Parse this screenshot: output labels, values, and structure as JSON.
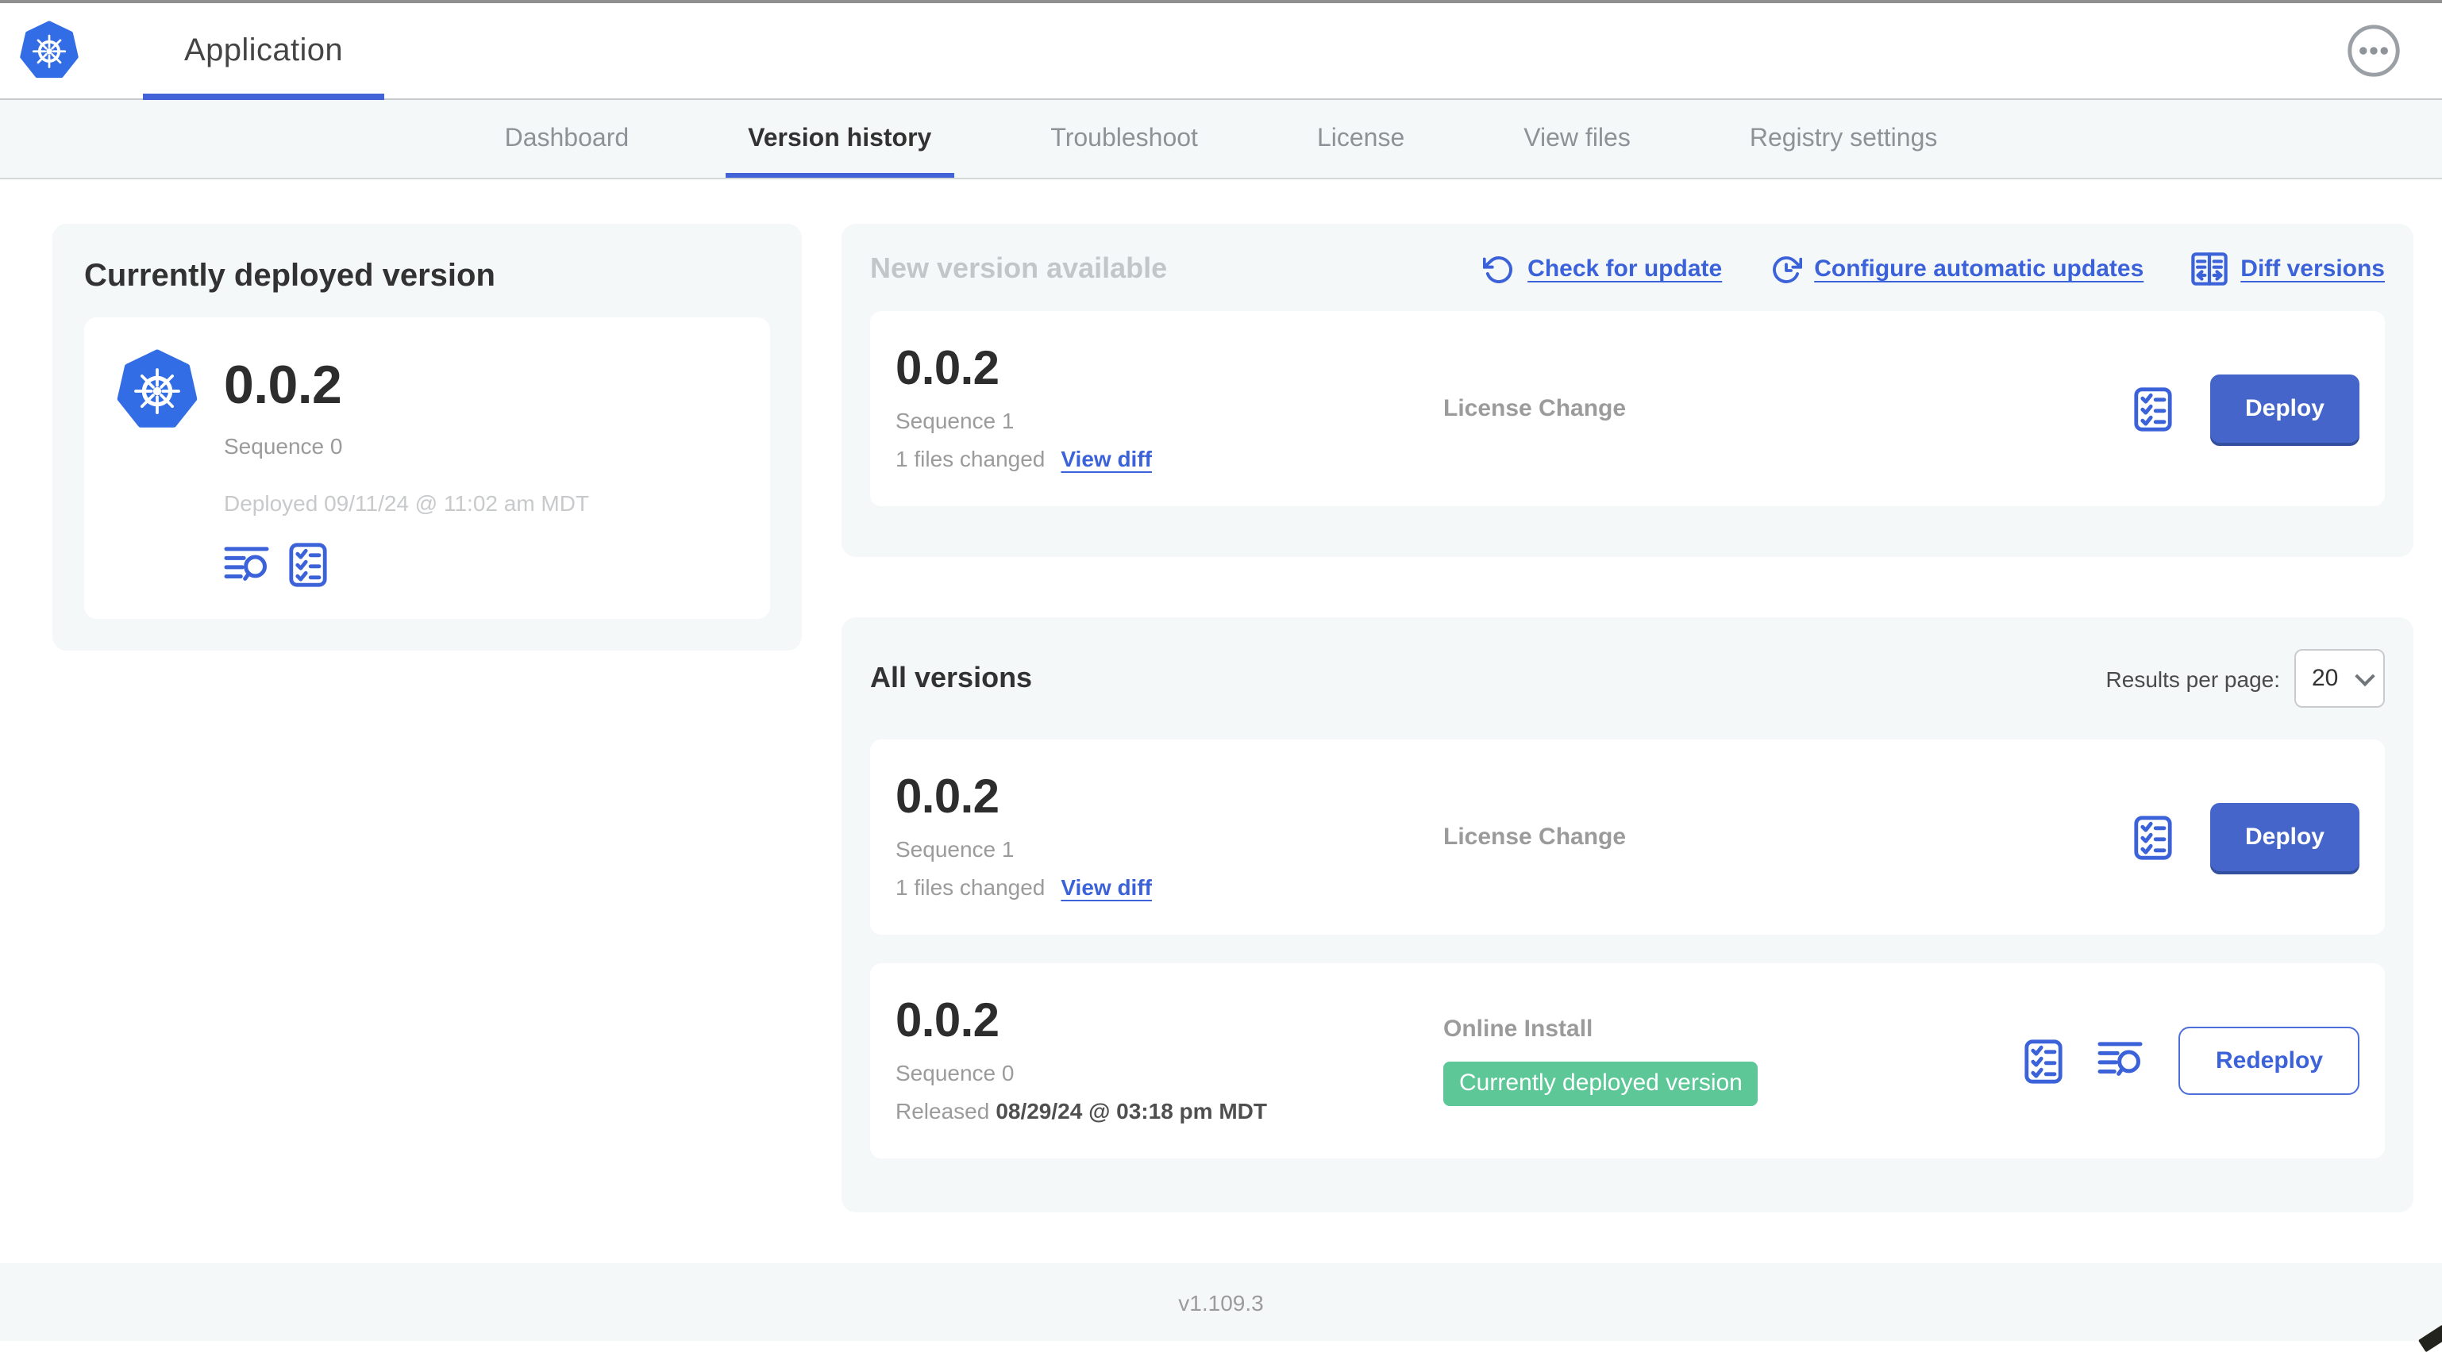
{
  "header": {
    "title": "Application"
  },
  "nav": {
    "tabs": [
      {
        "label": "Dashboard"
      },
      {
        "label": "Version history"
      },
      {
        "label": "Troubleshoot"
      },
      {
        "label": "License"
      },
      {
        "label": "View files"
      },
      {
        "label": "Registry settings"
      }
    ]
  },
  "deployed": {
    "title": "Currently deployed version",
    "version": "0.0.2",
    "sequence": "Sequence 0",
    "deployed_at": "Deployed 09/11/24 @ 11:02 am MDT"
  },
  "new_version": {
    "heading": "New version available",
    "links": [
      {
        "label": "Check for update",
        "icon": "rotate-ccw-icon"
      },
      {
        "label": "Configure automatic updates",
        "icon": "auto-update-clock-icon"
      },
      {
        "label": "Diff versions",
        "icon": "diff-columns-icon"
      }
    ],
    "card": {
      "version": "0.0.2",
      "sequence": "Sequence 1",
      "files_changed": "1 files changed",
      "view_diff": "View diff",
      "source": "License Change",
      "action": "Deploy"
    }
  },
  "all_versions": {
    "heading": "All versions",
    "results_label": "Results per page:",
    "results_value": "20",
    "rows": [
      {
        "version": "0.0.2",
        "sequence": "Sequence 1",
        "files_changed": "1 files changed",
        "view_diff": "View diff",
        "source": "License Change",
        "action": "Deploy"
      },
      {
        "version": "0.0.2",
        "sequence": "Sequence 0",
        "released_prefix": "Released",
        "released_date": "08/29/24 @ 03:18 pm MDT",
        "source": "Online Install",
        "badge": "Currently deployed version",
        "action": "Redeploy"
      }
    ]
  },
  "footer": {
    "app_version": "v1.109.3"
  },
  "colors": {
    "accent_blue": "#3b62d9",
    "button_blue": "#4565cb",
    "badge_green": "#5ec798",
    "panel_bg": "#f5f8f9",
    "k8s_blue": "#326de6"
  }
}
